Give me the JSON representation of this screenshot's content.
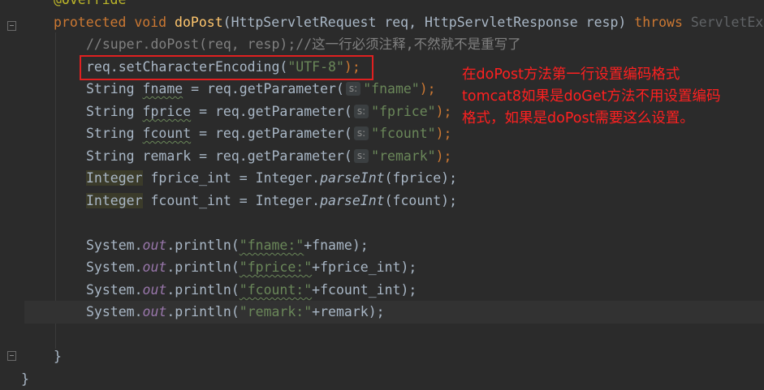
{
  "editor": {
    "annotation_text": "@Override",
    "signature": {
      "kw_protected": "protected",
      "kw_void": "void",
      "method": "doPost",
      "params": "(HttpServletRequest req, HttpServletResponse resp) ",
      "kw_throws": "throws",
      "exception": " ServletEx"
    },
    "comment": "//super.doPost(req, resp);//这一行必须注释,不然就不是重写了",
    "encoding_line": {
      "code": "req.setCharacterEncoding(",
      "arg": "\"UTF-8\"",
      "end": ");"
    },
    "param_lines": [
      {
        "type": "String ",
        "var": "fname",
        "mid": " = req.getParameter(",
        "hint": "s:",
        "arg": "\"fname\"",
        "end": ");"
      },
      {
        "type": "String ",
        "var": "fprice",
        "mid": " = req.getParameter(",
        "hint": "s:",
        "arg": "\"fprice\"",
        "end": ");"
      },
      {
        "type": "String ",
        "var": "fcount",
        "mid": " = req.getParameter(",
        "hint": "s:",
        "arg": "\"fcount\"",
        "end": ");"
      },
      {
        "type": "String ",
        "var": "remark",
        "mid": " = req.getParameter(",
        "hint": "s:",
        "arg": "\"remark\"",
        "end": ");"
      }
    ],
    "int_lines": [
      {
        "type": "Integer",
        "var": "fprice_int",
        "mid": " = Integer.",
        "call": "parseInt",
        "end": "(fprice);"
      },
      {
        "type": "Integer",
        "var": "fcount_int",
        "mid": " = Integer.",
        "call": "parseInt",
        "end": "(fcount);"
      }
    ],
    "print_lines": [
      {
        "pre": "System.",
        "field": "out",
        "mid": ".println(",
        "str": "\"fname:\"",
        "end": "+fname);"
      },
      {
        "pre": "System.",
        "field": "out",
        "mid": ".println(",
        "str": "\"fprice:\"",
        "end": "+fprice_int);"
      },
      {
        "pre": "System.",
        "field": "out",
        "mid": ".println(",
        "str": "\"fcount:\"",
        "end": "+fcount_int);"
      },
      {
        "pre": "System.",
        "field": "out",
        "mid": ".println(",
        "str": "\"remark:\"",
        "end": "+remark);"
      }
    ],
    "close_method": "}",
    "close_class": "}"
  },
  "annotation_note": {
    "lines": [
      "在doPost方法第一行设置编码格式",
      "tomcat8如果是doGet方法不用设置编码",
      "格式，如果是doPost需要这么设置。"
    ],
    "color": "#ff2020"
  }
}
